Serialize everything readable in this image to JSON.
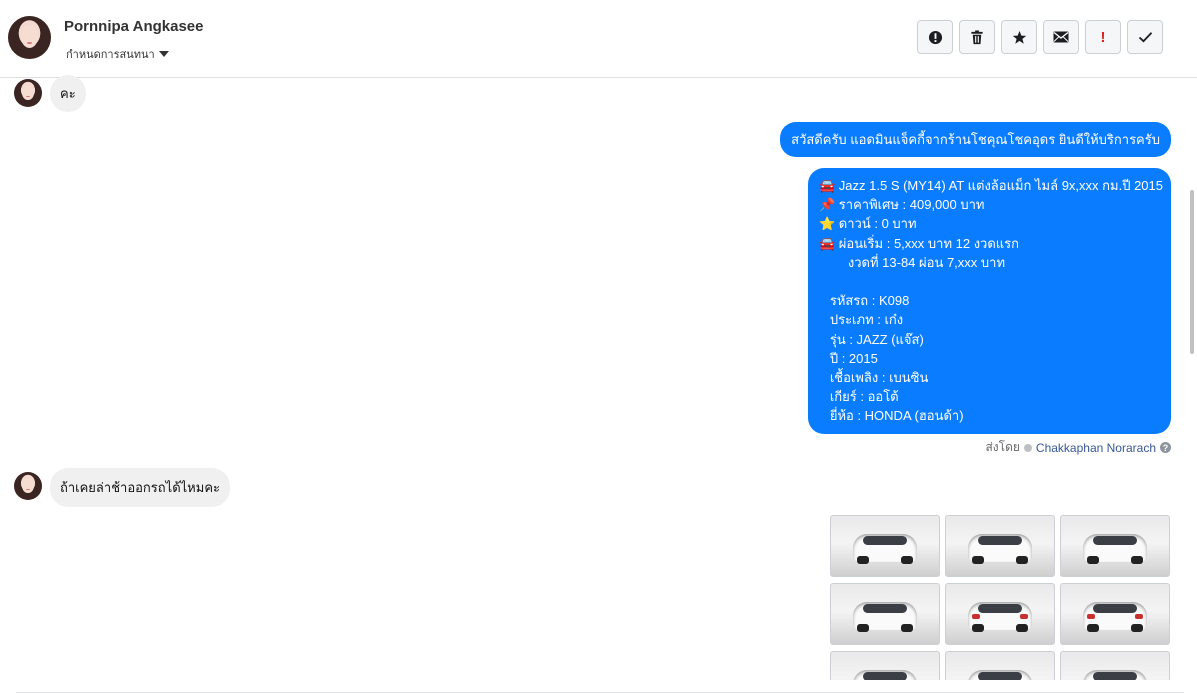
{
  "header": {
    "contact_name": "Pornnipa Angkasee",
    "subline": "กำหนดการสนทนา"
  },
  "toolbar": [
    {
      "name": "mark-spam-button",
      "icon": "alert-circle-icon"
    },
    {
      "name": "delete-button",
      "icon": "trash-icon"
    },
    {
      "name": "star-button",
      "icon": "star-icon"
    },
    {
      "name": "mark-unread-button",
      "icon": "envelope-icon"
    },
    {
      "name": "important-button",
      "icon": "exclamation-icon",
      "label": "!"
    },
    {
      "name": "done-button",
      "icon": "check-icon"
    }
  ],
  "messages": {
    "incoming_1": "คะ",
    "outgoing_1": "สวัสดีครับ แอดมินแจ็คกี้จากร้านโชคุณโชคอุดร ยินดีให้บริการครับ",
    "outgoing_2": [
      "🚘 Jazz 1.5 S (MY14) AT แต่งล้อแม็ก ไมล์ 9x,xxx กม.ปี 2015",
      "📌 ราคาพิเศษ : 409,000 บาท",
      "⭐ ดาวน์ : 0 บาท",
      "🚘 ผ่อนเริ่ม : 5,xxx บาท 12 งวดแรก",
      "        งวดที่ 13-84 ผ่อน 7,xxx บาท",
      "",
      "   รหัสรถ : K098",
      "   ประเภท : เก๋ง",
      "   รุ่น : JAZZ (แจ๊ส)",
      "   ปี : 2015",
      "   เชื้อเพลิง : เบนซิน",
      "   เกียร์ : ออโต้",
      "   ยี่ห้อ : HONDA (ฮอนด้า)"
    ],
    "sent_by_label": "ส่งโดย",
    "sent_by_name": "Chakkaphan Norarach",
    "help_glyph": "?",
    "incoming_2": "ถ้าเคยล่าช้าออกรถได้ไหมคะ"
  },
  "photos": [
    {
      "name": "car-photo-rear-open"
    },
    {
      "name": "car-photo-front-left"
    },
    {
      "name": "car-photo-front"
    },
    {
      "name": "car-photo-side-left"
    },
    {
      "name": "car-photo-rear"
    },
    {
      "name": "car-photo-rear-right"
    },
    {
      "name": "car-photo-rear-left"
    },
    {
      "name": "car-photo-side"
    },
    {
      "name": "car-photo-front-close"
    }
  ],
  "colors": {
    "outgoing_bubble": "#0a7cff",
    "incoming_bubble": "#f0f0f0",
    "important": "#e02020"
  }
}
